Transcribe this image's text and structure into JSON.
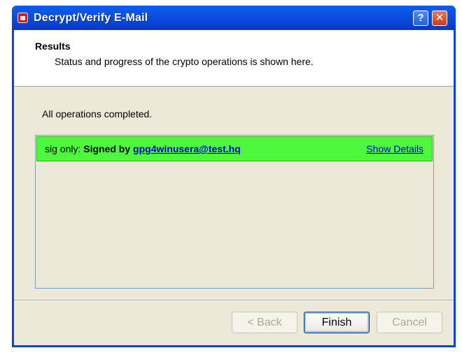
{
  "window": {
    "title": "Decrypt/Verify E-Mail",
    "help_label": "?",
    "close_label": "✕"
  },
  "header": {
    "title": "Results",
    "subtitle": "Status and progress of the crypto operations is shown here."
  },
  "status": {
    "message": "All operations completed."
  },
  "result": {
    "prefix": "sig only:",
    "signed_by": "Signed by",
    "email": "gpg4winusera@test.hq",
    "details_link": "Show Details",
    "color": "#4df83f"
  },
  "buttons": {
    "back": "< Back",
    "finish": "Finish",
    "cancel": "Cancel"
  }
}
